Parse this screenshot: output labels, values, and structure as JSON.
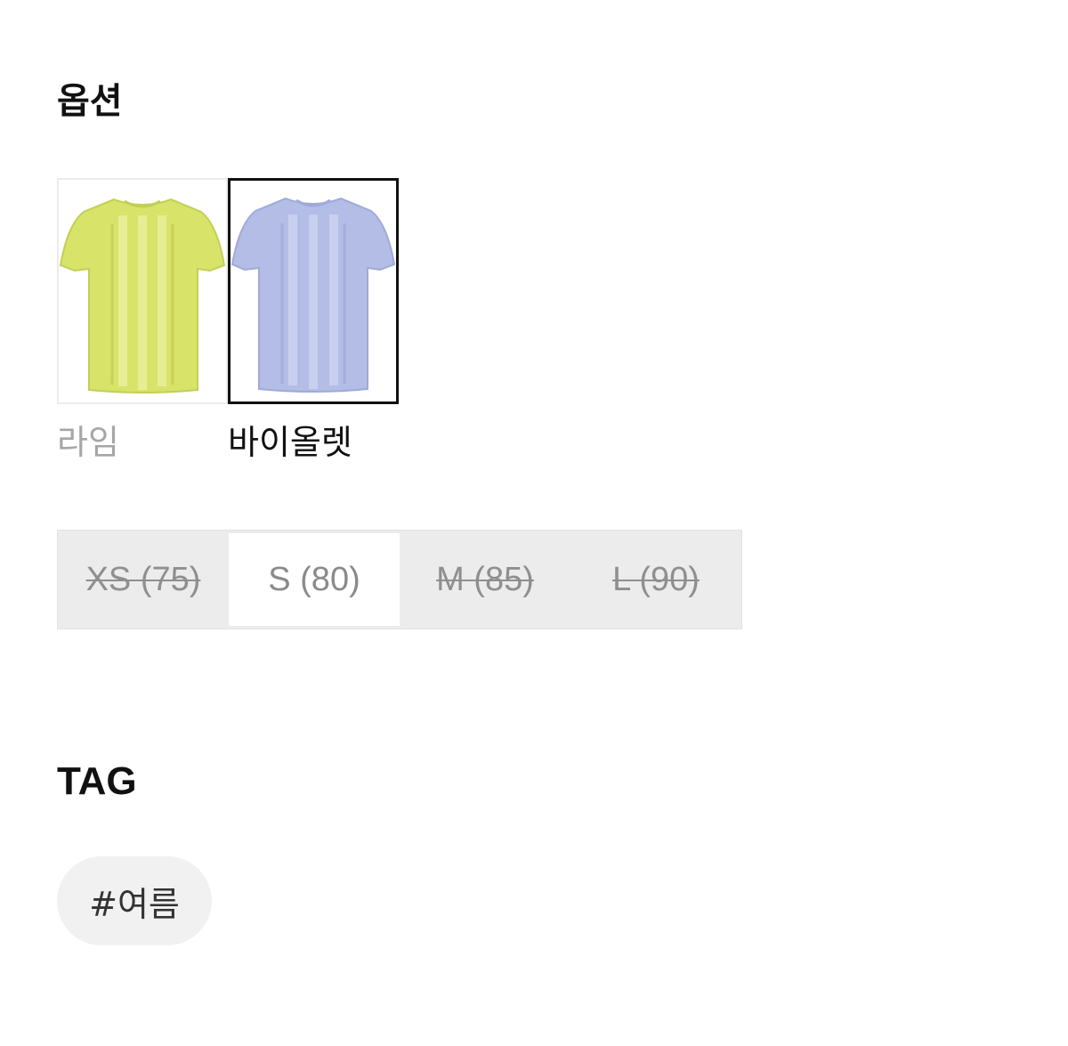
{
  "options": {
    "title": "옵션",
    "colors": [
      {
        "label": "라임",
        "swatch_color": "#d8e36a",
        "selected": false
      },
      {
        "label": "바이올렛",
        "swatch_color": "#b3bde6",
        "selected": true
      }
    ],
    "sizes": [
      {
        "label": "XS (75)",
        "soldout": true
      },
      {
        "label": "S (80)",
        "soldout": false
      },
      {
        "label": "M (85)",
        "soldout": true
      },
      {
        "label": "L (90)",
        "soldout": true
      }
    ]
  },
  "tags": {
    "title": "TAG",
    "items": [
      "#여름"
    ]
  }
}
